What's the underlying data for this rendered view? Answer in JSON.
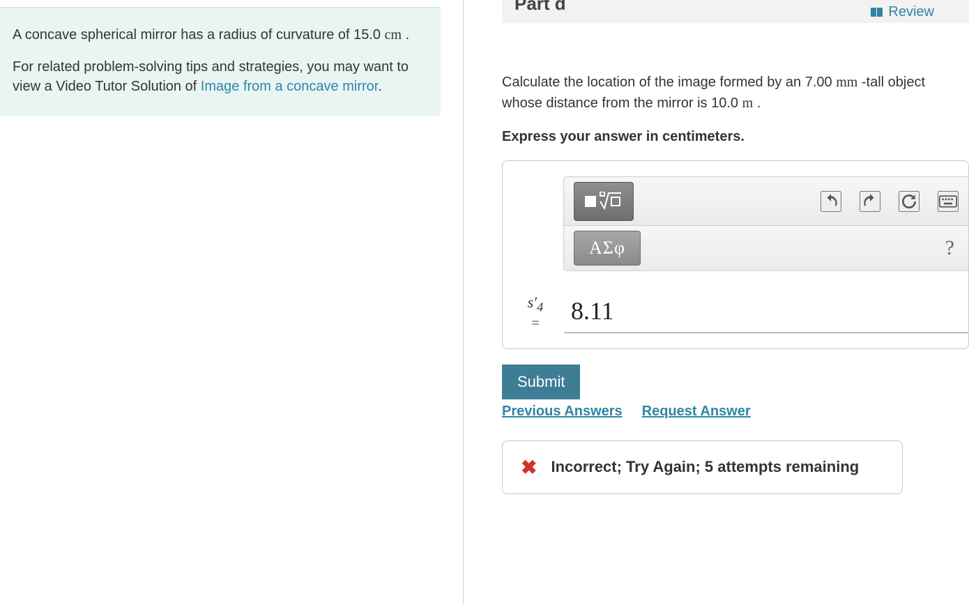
{
  "review_label": "Review",
  "part_header": "Part d",
  "problem": {
    "p1a": "A concave spherical mirror has a radius of curvature of 15.0 ",
    "p1_unit": "cm",
    "p1b": " .",
    "p2a": "For related problem-solving tips and strategies, you may want to view a Video Tutor Solution of ",
    "video_link": "Image from a concave mirror",
    "p2b": "."
  },
  "question": {
    "q1a": "Calculate the location of the image formed by an 7.00 ",
    "q1_unit1": "mm",
    "q1b": " -tall object whose distance from the mirror is 10.0 ",
    "q1_unit2": "m",
    "q1c": " .",
    "instruction": "Express your answer in centimeters."
  },
  "toolbar": {
    "greek_label": "ΑΣφ",
    "help_label": "?"
  },
  "answer": {
    "var_html": "s′",
    "var_sub": "4",
    "eq": "=",
    "value": "8.11"
  },
  "buttons": {
    "submit": "Submit",
    "previous": "Previous Answers",
    "request": "Request Answer"
  },
  "feedback": {
    "icon": "✖",
    "text": "Incorrect; Try Again; 5 attempts remaining"
  }
}
